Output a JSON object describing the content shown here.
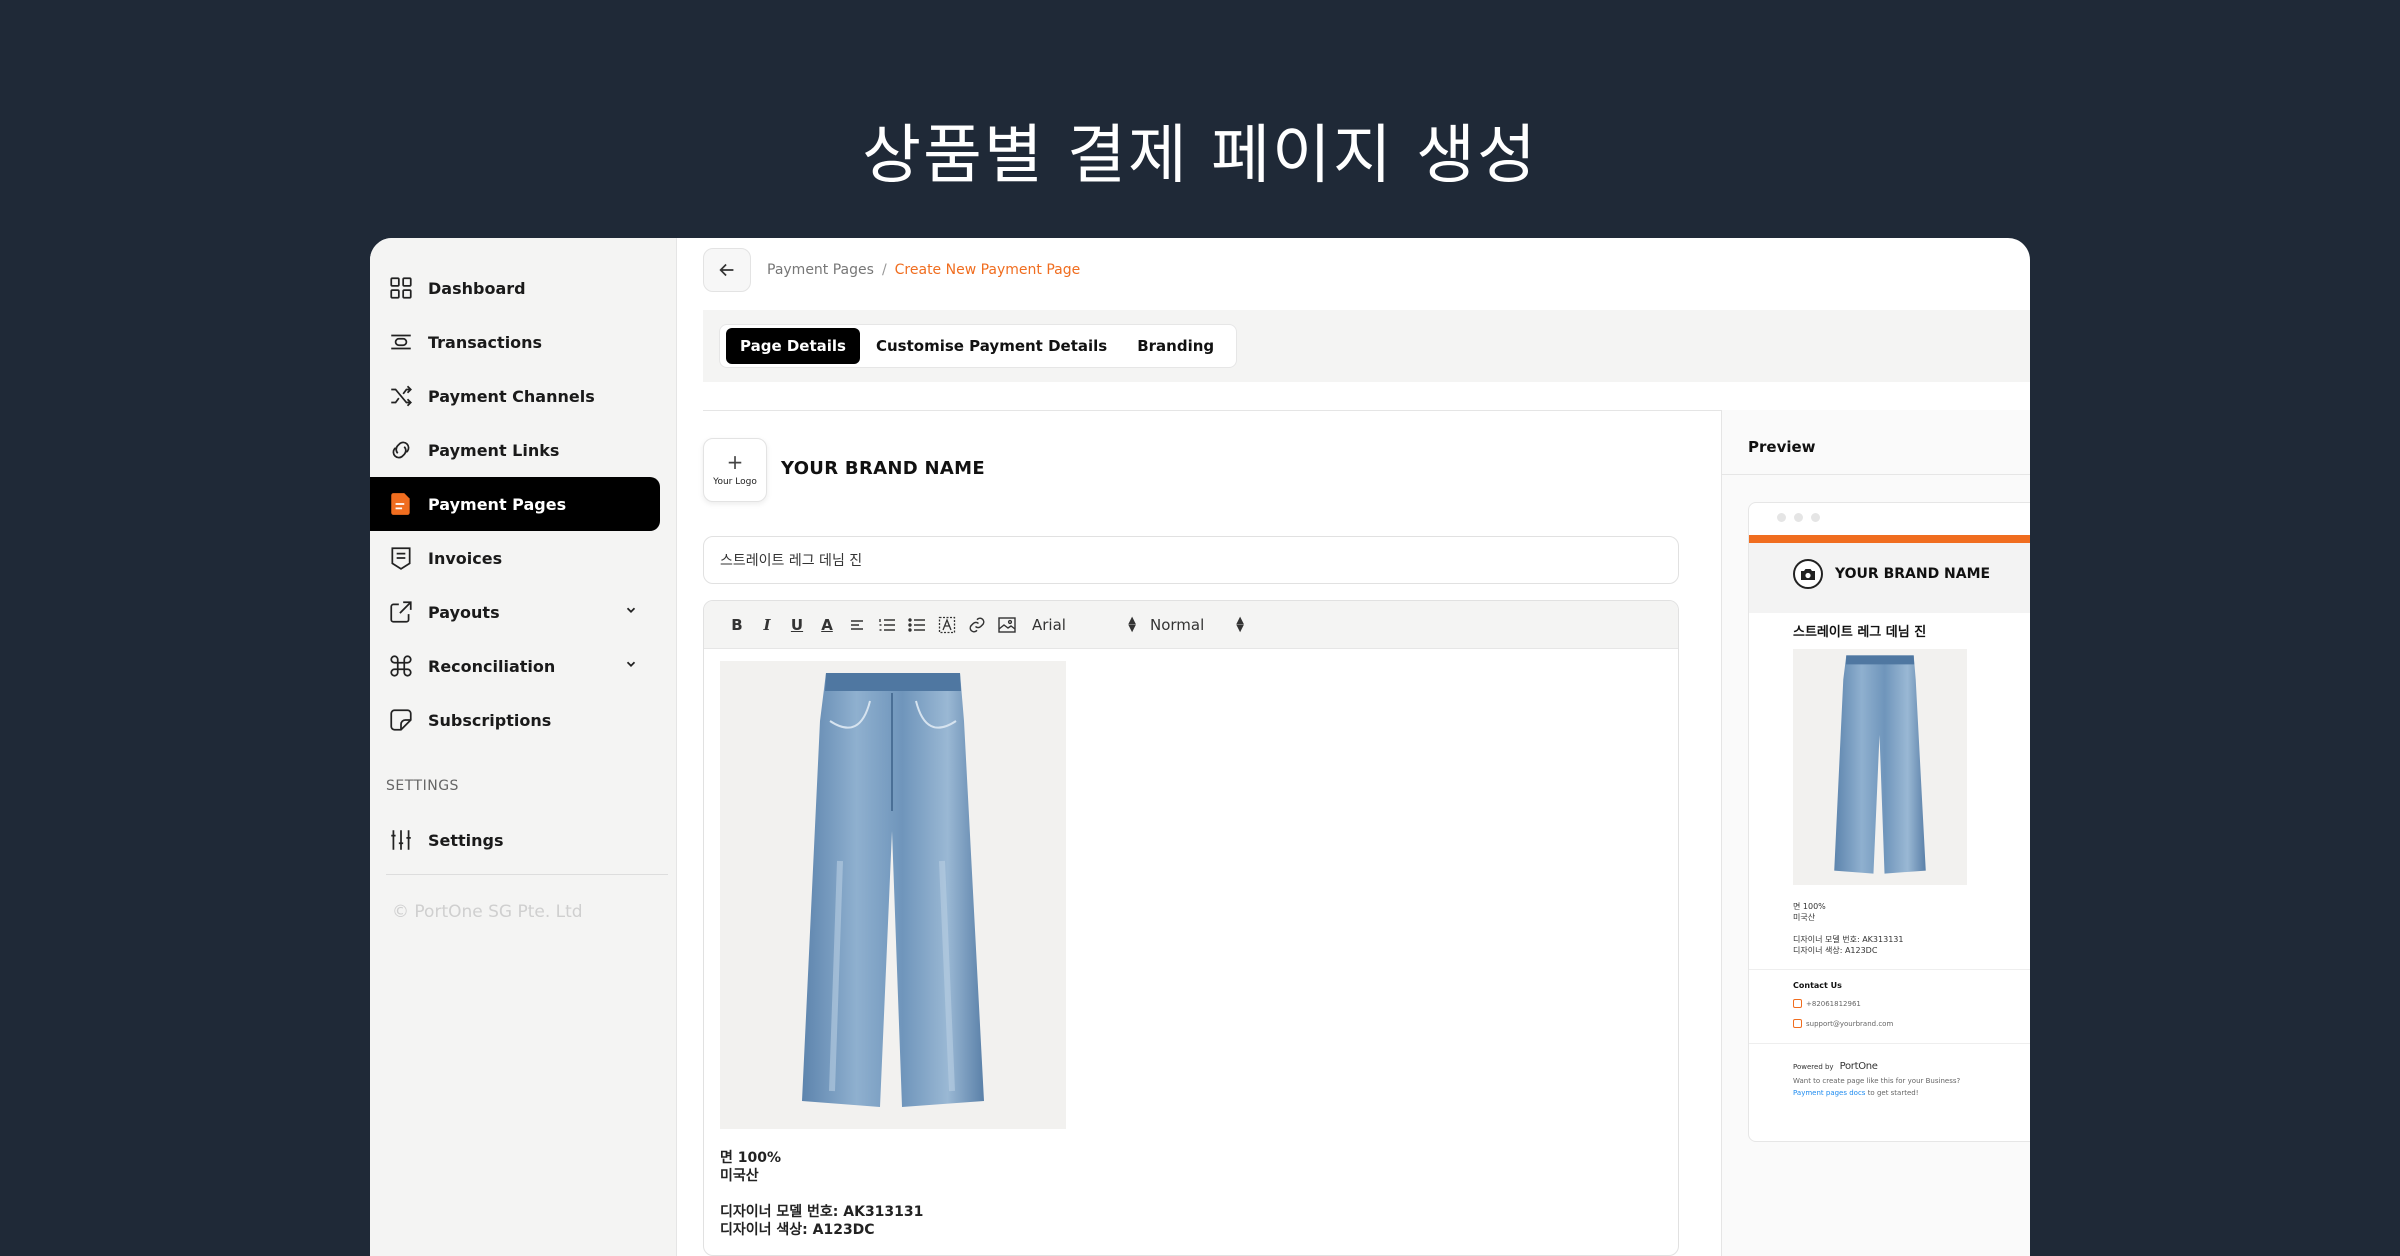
{
  "hero": {
    "title": "상품별 결제 페이지 생성"
  },
  "sidebar": {
    "items": [
      {
        "label": "Dashboard",
        "icon": "grid-icon"
      },
      {
        "label": "Transactions",
        "icon": "transactions-icon"
      },
      {
        "label": "Payment Channels",
        "icon": "shuffle-icon"
      },
      {
        "label": "Payment Links",
        "icon": "link-icon"
      },
      {
        "label": "Payment Pages",
        "icon": "document-icon",
        "active": true
      },
      {
        "label": "Invoices",
        "icon": "invoice-icon"
      },
      {
        "label": "Payouts",
        "icon": "external-icon",
        "expandable": true
      },
      {
        "label": "Reconciliation",
        "icon": "command-icon",
        "expandable": true
      },
      {
        "label": "Subscriptions",
        "icon": "sticker-icon"
      }
    ],
    "settings_section_label": "SETTINGS",
    "settings_item": {
      "label": "Settings",
      "icon": "sliders-icon"
    },
    "copyright": "© PortOne SG Pte. Ltd"
  },
  "breadcrumb": {
    "parent": "Payment Pages",
    "separator": "/",
    "current": "Create New Payment Page"
  },
  "tabs": [
    {
      "label": "Page Details",
      "active": true
    },
    {
      "label": "Customise Payment Details"
    },
    {
      "label": "Branding"
    }
  ],
  "editor": {
    "logo_placeholder": "+",
    "logo_caption": "Your Logo",
    "brand_name": "YOUR BRAND NAME",
    "title_value": "스트레이트 레그 데님 진",
    "toolbar": {
      "bold": "B",
      "italic": "I",
      "underline": "U",
      "color": "A",
      "font_family": "Arial",
      "font_size": "Normal"
    },
    "description": {
      "line1": "면 100%",
      "line2": "미국산",
      "line3": "디자이너 모델 번호: AK313131",
      "line4": "디자이너 색상: A123DC"
    }
  },
  "preview": {
    "title": "Preview",
    "brand_name": "YOUR BRAND NAME",
    "product_title": "스트레이트 레그 데님 진",
    "desc_line1": "면 100%",
    "desc_line2": "미국산",
    "desc_line3": "디자이너 모델 번호: AK313131",
    "desc_line4": "디자이너 색상: A123DC",
    "contact_title": "Contact Us",
    "phone": "+82061812961",
    "email": "support@yourbrand.com",
    "powered_by": "Powered by",
    "powered_brand": "PortOne",
    "footer_line1": "Want to create page like this for your Business?",
    "footer_link": "Payment pages docs",
    "footer_suffix": "to get started!"
  },
  "colors": {
    "accent": "#f06d1f",
    "background": "#1f2937",
    "active_nav": "#000000"
  }
}
